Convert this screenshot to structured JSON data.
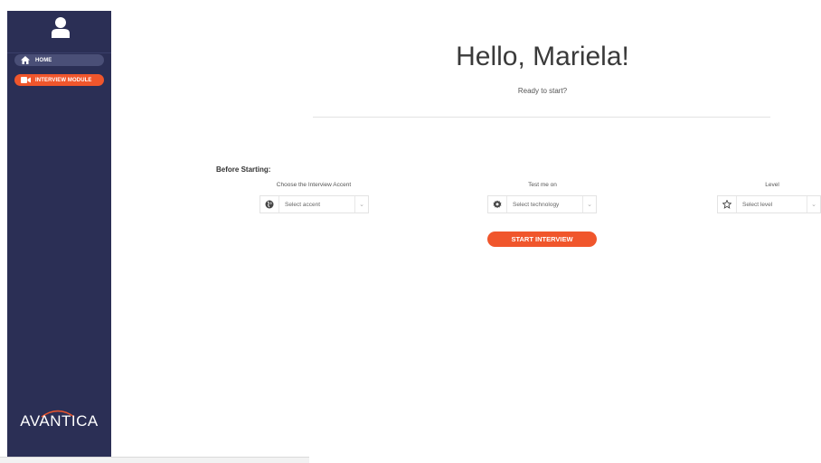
{
  "sidebar": {
    "nav": [
      {
        "label": "HOME",
        "icon": "home-icon"
      },
      {
        "label": "INTERVIEW MODULE",
        "icon": "video-camera-icon"
      }
    ],
    "logo_text": "AVANTICA"
  },
  "main": {
    "greeting": "Hello, Mariela!",
    "subtitle": "Ready to start?",
    "section_label": "Before Starting:",
    "fields": [
      {
        "label": "Choose the Interview Accent",
        "placeholder": "Select accent",
        "icon": "globe-icon"
      },
      {
        "label": "Test me on",
        "placeholder": "Select technology",
        "icon": "gear-icon"
      },
      {
        "label": "Level",
        "placeholder": "Select level",
        "icon": "star-icon"
      }
    ],
    "start_button": "START INTERVIEW"
  },
  "colors": {
    "sidebar_bg": "#2b2f55",
    "accent": "#f0562c"
  }
}
